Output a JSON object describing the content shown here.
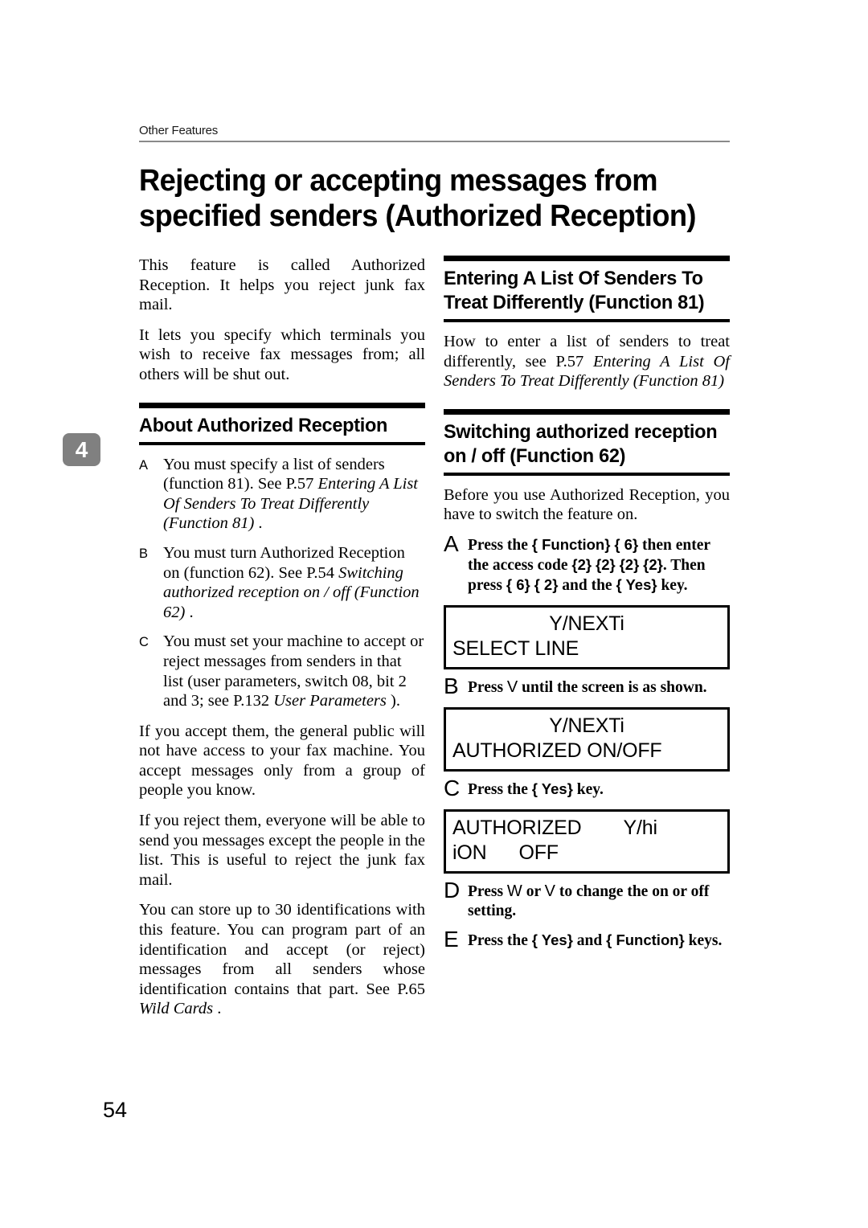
{
  "header": {
    "running_head": "Other Features",
    "chapter_tab": "4",
    "page_number": "54",
    "title": "Rejecting or accepting messages from specified senders (Authorized Reception)"
  },
  "left_column": {
    "intro_paragraphs": [
      "This feature is called Authorized Reception. It helps you reject junk fax mail.",
      "It lets you specify which terminals you wish to receive fax messages from; all others will be shut out."
    ],
    "section_heading": "About Authorized Reception",
    "alpha_items": [
      {
        "mark": "A",
        "lead": "You must specify a list of senders (function 81). See P.57 ",
        "italic": "Entering A List Of Senders To Treat Differently (Function 81)",
        "tail": " ."
      },
      {
        "mark": "B",
        "lead": "You must turn Authorized Reception on (function 62). See P.54 ",
        "italic": "Switching authorized reception on / off (Function 62)",
        "tail": " ."
      },
      {
        "mark": "C",
        "lead": "You must set your machine to accept or reject messages from senders in that list (user parameters, switch 08, bit 2 and 3; see P.132 ",
        "italic": "User Parameters",
        "tail": " )."
      }
    ],
    "closing_paragraphs": [
      "If you accept them, the general public will not have access to your fax machine. You accept messages only from a group of people you know.",
      "If you reject them, everyone will be able to send you messages except the people in the list. This is useful to reject the junk fax mail."
    ],
    "final_paragraph": {
      "lead": "You can store up to 30 identifications with this feature. You can program part of an identification and accept (or reject) messages from all senders whose identification contains that part. See P.65 ",
      "italic": "Wild Cards",
      "tail": " ."
    }
  },
  "right_column": {
    "section1": {
      "heading": "Entering A List Of Senders To Treat Differently (Function 81)",
      "body": {
        "lead": "How to enter a list of senders to treat differently, see P.57 ",
        "italic": "Entering A List Of Senders To Treat Differently (Function 81)",
        "tail": ""
      }
    },
    "section2": {
      "heading": "Switching authorized reception on / off (Function 62)",
      "intro": "Before you use Authorized Reception, you have to switch the feature on.",
      "steps": [
        {
          "mark": "A",
          "parts": [
            {
              "t": "Press the ",
              "k": false
            },
            {
              "t": "{ Function}",
              "k": true
            },
            {
              "t": " ",
              "k": false
            },
            {
              "t": "{ 6}",
              "k": true
            },
            {
              "t": " then enter the access code ",
              "k": false
            },
            {
              "t": "{2}",
              "k": true
            },
            {
              "t": " ",
              "k": false
            },
            {
              "t": "{2}",
              "k": true
            },
            {
              "t": " ",
              "k": false
            },
            {
              "t": "{2}",
              "k": true
            },
            {
              "t": " ",
              "k": false
            },
            {
              "t": "{2}",
              "k": true
            },
            {
              "t": ". Then press ",
              "k": false
            },
            {
              "t": "{ 6}",
              "k": true
            },
            {
              "t": " ",
              "k": false
            },
            {
              "t": "{ 2}",
              "k": true
            },
            {
              "t": " and the ",
              "k": false
            },
            {
              "t": "{ Yes}",
              "k": true
            },
            {
              "t": " key.",
              "k": false
            }
          ]
        },
        {
          "mark": "B",
          "parts": [
            {
              "t": "Press ",
              "k": false
            },
            {
              "t": "V",
              "k": true
            },
            {
              "t": " until the screen is as shown.",
              "k": false
            }
          ]
        },
        {
          "mark": "C",
          "parts": [
            {
              "t": "Press the ",
              "k": false
            },
            {
              "t": "{ Yes}",
              "k": true
            },
            {
              "t": " key.",
              "k": false
            }
          ]
        },
        {
          "mark": "D",
          "parts": [
            {
              "t": "Press ",
              "k": false
            },
            {
              "t": "W",
              "k": true
            },
            {
              "t": " or ",
              "k": false
            },
            {
              "t": "V",
              "k": true
            },
            {
              "t": " to change the on or off setting.",
              "k": false
            }
          ]
        },
        {
          "mark": "E",
          "parts": [
            {
              "t": "Press the ",
              "k": false
            },
            {
              "t": "{ Yes}",
              "k": true
            },
            {
              "t": " and ",
              "k": false
            },
            {
              "t": "{ Function}",
              "k": true
            },
            {
              "t": " keys.",
              "k": false
            }
          ]
        }
      ],
      "screens": [
        {
          "line1": "Y/NEXTi",
          "line2_a": "SELECT LINE",
          "line2_b": ""
        },
        {
          "line1": "Y/NEXTi",
          "line2_a": "AUTHORIZED ON/OFF",
          "line2_b": ""
        },
        {
          "line1_a": "AUTHORIZED",
          "line1_b": "Y/hi",
          "line2_a": "iON",
          "line2_b": "OFF"
        }
      ]
    }
  }
}
